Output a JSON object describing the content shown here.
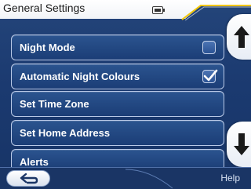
{
  "window": {
    "title": "General Settings"
  },
  "status": {
    "battery_icon": "battery-icon"
  },
  "menu": {
    "items": [
      {
        "label": "Night Mode",
        "checked": false
      },
      {
        "label": "Automatic Night Colours",
        "checked": true
      },
      {
        "label": "Set Time Zone"
      },
      {
        "label": "Set Home Address"
      },
      {
        "label": "Alerts"
      }
    ]
  },
  "scroll": {
    "up_icon": "arrow-up-icon",
    "down_icon": "arrow-down-icon"
  },
  "bottom": {
    "back_icon": "back-arrow-icon",
    "help_label": "Help"
  },
  "colors": {
    "background": "#1b3a70",
    "accent": "#f2c600",
    "button_border": "#b8c8e6"
  }
}
